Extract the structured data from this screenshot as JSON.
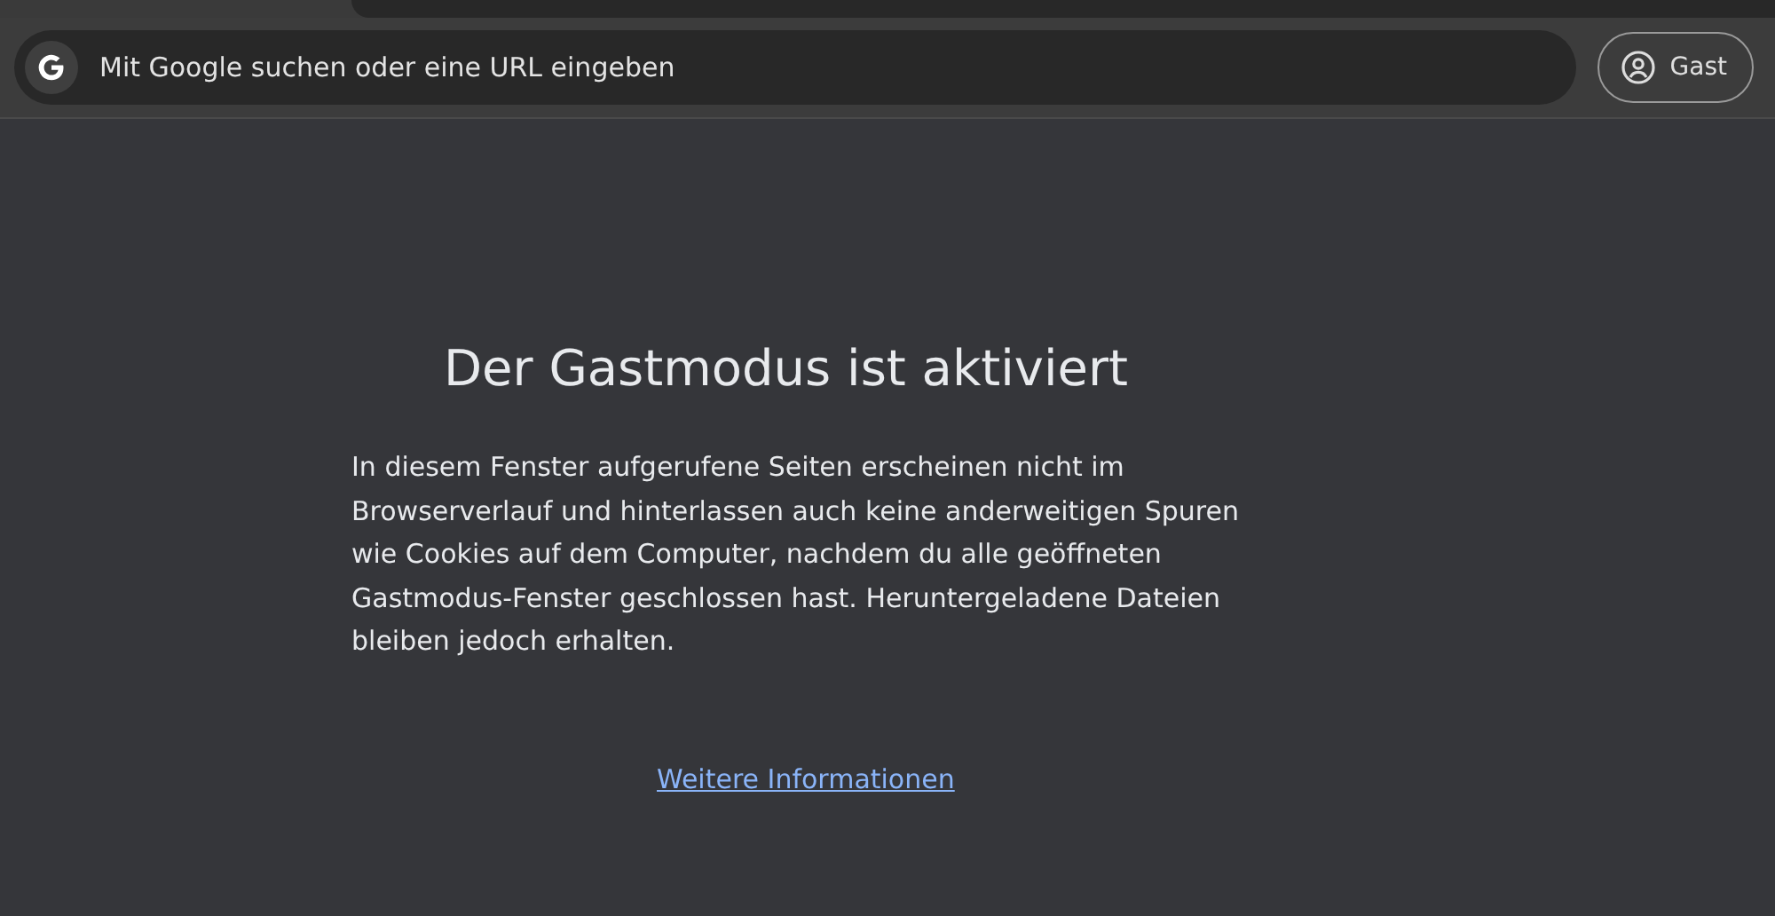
{
  "omnibox": {
    "placeholder": "Mit Google suchen oder eine URL eingeben"
  },
  "profile_button": {
    "label": "Gast"
  },
  "content": {
    "title": "Der Gastmodus ist aktiviert",
    "text": "In diesem Fenster aufgerufene Seiten erscheinen nicht im Browserverlauf und hinterlassen auch keine anderweitigen Spuren wie Cookies auf dem Computer, nachdem du alle geöffneten Gastmodus-Fenster geschlossen hast. Heruntergeladene Dateien bleiben jedoch erhalten.",
    "link": "Weitere Informationen"
  }
}
